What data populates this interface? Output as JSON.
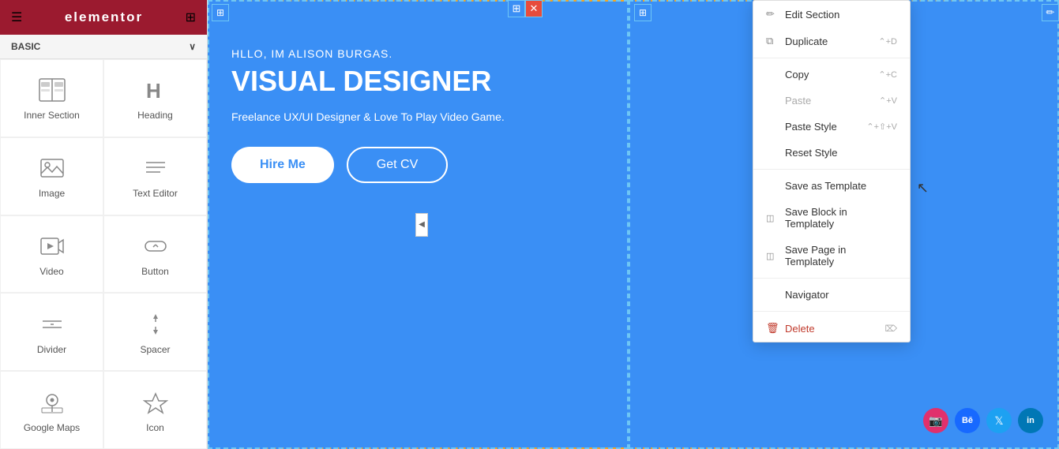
{
  "topbar": {
    "logo": "elementor",
    "hamburger_icon": "☰",
    "grid_icon": "⊞"
  },
  "sidebar": {
    "section_label": "BASIC",
    "chevron": "∨",
    "widgets": [
      {
        "id": "inner-section",
        "icon": "inner_section",
        "label": "Inner Section"
      },
      {
        "id": "heading",
        "icon": "heading",
        "label": "Heading"
      },
      {
        "id": "image",
        "icon": "image",
        "label": "Image"
      },
      {
        "id": "text-editor",
        "icon": "text_editor",
        "label": "Text Editor"
      },
      {
        "id": "video",
        "icon": "video",
        "label": "Video"
      },
      {
        "id": "button",
        "icon": "button",
        "label": "Button"
      },
      {
        "id": "divider",
        "icon": "divider",
        "label": "Divider"
      },
      {
        "id": "spacer",
        "icon": "spacer",
        "label": "Spacer"
      },
      {
        "id": "google-maps",
        "icon": "maps",
        "label": "Google Maps"
      },
      {
        "id": "icon",
        "icon": "icon",
        "label": "Icon"
      }
    ]
  },
  "canvas": {
    "hello_text": "HLLO, IM ALISON BURGAS.",
    "title_text": "VISUAL DESIGNER",
    "subtitle_text": "Freelance UX/UI Designer & Love To Play Video Game.",
    "hire_me": "Hire Me",
    "get_cv": "Get CV",
    "social_icons": [
      "instagram",
      "behance",
      "twitter",
      "linkedin"
    ]
  },
  "context_menu": {
    "items": [
      {
        "id": "edit-section",
        "icon": "✏",
        "label": "Edit Section",
        "shortcut": "",
        "disabled": false
      },
      {
        "id": "duplicate",
        "icon": "⧉",
        "label": "Duplicate",
        "shortcut": "⌃+D",
        "disabled": false
      },
      {
        "id": "copy",
        "icon": "",
        "label": "Copy",
        "shortcut": "⌃+C",
        "disabled": false
      },
      {
        "id": "paste",
        "icon": "",
        "label": "Paste",
        "shortcut": "⌃+V",
        "disabled": true
      },
      {
        "id": "paste-style",
        "icon": "",
        "label": "Paste Style",
        "shortcut": "⌃+⇧+V",
        "disabled": false
      },
      {
        "id": "reset-style",
        "icon": "",
        "label": "Reset Style",
        "shortcut": "",
        "disabled": false
      },
      {
        "id": "save-as-template",
        "icon": "",
        "label": "Save as Template",
        "shortcut": "",
        "disabled": false
      },
      {
        "id": "save-block",
        "icon": "◫",
        "label": "Save Block in Templately",
        "shortcut": "",
        "disabled": false
      },
      {
        "id": "save-page",
        "icon": "◫",
        "label": "Save Page in Templately",
        "shortcut": "",
        "disabled": false
      },
      {
        "id": "navigator",
        "icon": "",
        "label": "Navigator",
        "shortcut": "",
        "disabled": false
      },
      {
        "id": "delete",
        "icon": "🗑",
        "label": "Delete",
        "shortcut": "⌦",
        "disabled": false
      }
    ]
  }
}
